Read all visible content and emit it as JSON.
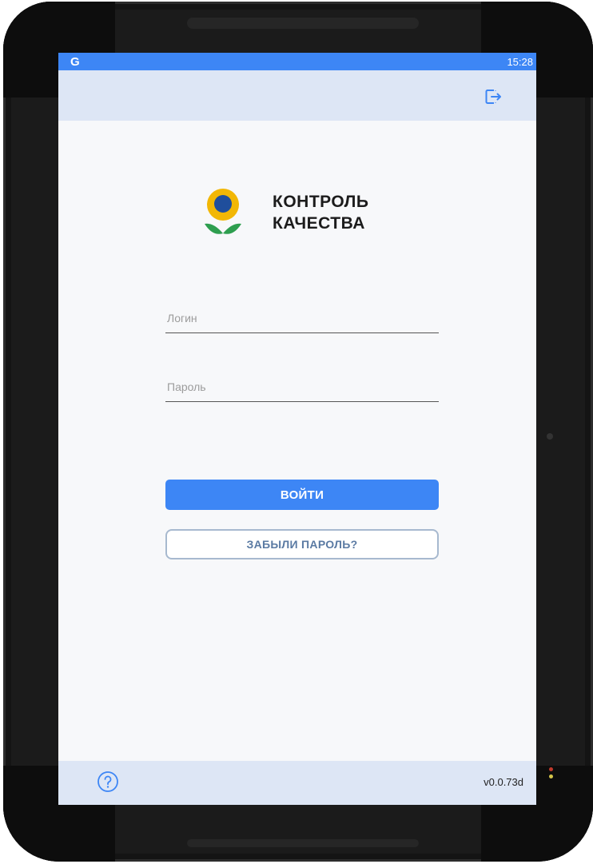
{
  "status_bar": {
    "app_indicator": "G",
    "time": "15:28"
  },
  "header": {
    "logout_icon": "logout-icon"
  },
  "logo": {
    "line1": "КОНТРОЛЬ",
    "line2": "КАЧЕСТВА",
    "colors": {
      "petals": "#f2b705",
      "center": "#1f4e9c",
      "leaves": "#2e9e4f"
    }
  },
  "form": {
    "login_placeholder": "Логин",
    "login_value": "",
    "password_placeholder": "Пароль",
    "password_value": "",
    "submit_label": "ВОЙТИ",
    "forgot_label": "ЗАБЫЛИ ПАРОЛЬ?"
  },
  "footer": {
    "help_icon": "help-icon",
    "version": "v0.0.73d"
  },
  "colors": {
    "accent": "#3d86f5",
    "bar_background": "#dde6f5"
  }
}
